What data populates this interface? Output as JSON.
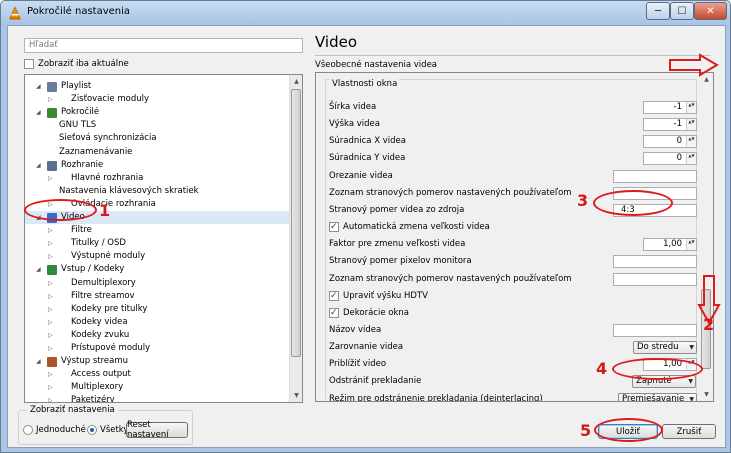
{
  "window": {
    "title": "Pokročilé nastavenia",
    "controls": {
      "minimize": "─",
      "maximize": "☐",
      "close": "✕"
    }
  },
  "search": {
    "placeholder": "Hľadať"
  },
  "only_current": {
    "label": "Zobraziť iba aktuálne",
    "checked": false
  },
  "tree": [
    {
      "label": "Playlist",
      "level": 0,
      "expanded": true,
      "icon": "playlist-icon",
      "color": "#6a7da0"
    },
    {
      "label": "Zisťovacie moduly",
      "level": 1,
      "expanded": false
    },
    {
      "label": "Pokročilé",
      "level": 0,
      "expanded": true,
      "icon": "advanced-icon",
      "color": "#3a8a30"
    },
    {
      "label": "GNU TLS",
      "level": 1,
      "leaf": true
    },
    {
      "label": "Sieťová synchronizácia",
      "level": 1,
      "leaf": true
    },
    {
      "label": "Zaznamenávanie",
      "level": 1,
      "leaf": true
    },
    {
      "label": "Rozhranie",
      "level": 0,
      "expanded": true,
      "icon": "interface-icon",
      "color": "#5b6f92"
    },
    {
      "label": "Hlavné rozhrania",
      "level": 1,
      "expanded": false
    },
    {
      "label": "Nastavenia klávesových skratiek",
      "level": 1,
      "leaf": true
    },
    {
      "label": "Ovládacie rozhrania",
      "level": 1,
      "expanded": false
    },
    {
      "label": "Video",
      "level": 0,
      "expanded": true,
      "icon": "video-icon",
      "color": "#2f6fd0",
      "selected": true
    },
    {
      "label": "Filtre",
      "level": 1,
      "expanded": false
    },
    {
      "label": "Titulky / OSD",
      "level": 1,
      "expanded": false
    },
    {
      "label": "Výstupné moduly",
      "level": 1,
      "expanded": false
    },
    {
      "label": "Vstup / Kodeky",
      "level": 0,
      "expanded": true,
      "icon": "input-codecs-icon",
      "color": "#2c8a3c"
    },
    {
      "label": "Demultiplexory",
      "level": 1,
      "expanded": false
    },
    {
      "label": "Filtre streamov",
      "level": 1,
      "expanded": false
    },
    {
      "label": "Kodeky pre titulky",
      "level": 1,
      "expanded": false
    },
    {
      "label": "Kodeky videa",
      "level": 1,
      "expanded": false
    },
    {
      "label": "Kodeky zvuku",
      "level": 1,
      "expanded": false
    },
    {
      "label": "Prístupové moduly",
      "level": 1,
      "expanded": false
    },
    {
      "label": "Výstup streamu",
      "level": 0,
      "expanded": true,
      "icon": "stream-output-icon",
      "color": "#b0522a"
    },
    {
      "label": "Access output",
      "level": 1,
      "expanded": false
    },
    {
      "label": "Multiplexory",
      "level": 1,
      "expanded": false
    },
    {
      "label": "Paketizéry",
      "level": 1,
      "expanded": false
    }
  ],
  "show_settings": {
    "caption": "Zobraziť nastavenia",
    "simple": "Jednoduché",
    "all": "Všetky",
    "selected": "all"
  },
  "reset_button": "Reset nastavení",
  "page": {
    "title": "Video",
    "section": "Všeobecné nastavenia videa",
    "group": "Vlastnosti okna"
  },
  "fields": [
    {
      "label": "Šírka videa",
      "type": "spin",
      "value": "-1"
    },
    {
      "label": "Výška videa",
      "type": "spin",
      "value": "-1"
    },
    {
      "label": "Súradnica X videa",
      "type": "spin",
      "value": "0"
    },
    {
      "label": "Súradnica Y videa",
      "type": "spin",
      "value": "0"
    },
    {
      "label": "Orezanie videa",
      "type": "text",
      "value": ""
    },
    {
      "label": "Zoznam stranových pomerov nastavených používateľom",
      "type": "text",
      "value": ""
    },
    {
      "label": "Stranový pomer videa zo zdroja",
      "type": "text",
      "value": "4:3"
    },
    {
      "label": "Automatická zmena veľkosti videa",
      "type": "checkbox",
      "checked": true
    },
    {
      "label": "Faktor pre zmenu veľkosti videa",
      "type": "spin",
      "value": "1,00"
    },
    {
      "label": "Stranový pomer pixelov monitora",
      "type": "text",
      "value": ""
    },
    {
      "label": "Zoznam stranových pomerov nastavených používateľom",
      "type": "text",
      "value": ""
    },
    {
      "label": "Upraviť výšku HDTV",
      "type": "checkbox",
      "checked": true
    },
    {
      "label": "Dekorácie okna",
      "type": "checkbox",
      "checked": true
    },
    {
      "label": "Názov videa",
      "type": "text",
      "value": ""
    },
    {
      "label": "Zarovnanie videa",
      "type": "combo",
      "value": "Do stredu"
    },
    {
      "label": "Priblížiť video",
      "type": "spin",
      "value": "1,00"
    },
    {
      "label": "Odstrániť prekladanie",
      "type": "combo",
      "value": "Zapnuté"
    },
    {
      "label": "Režim pre odstránenie prekladania (deinterlacing)",
      "type": "combo",
      "value": "Premiešavanie"
    }
  ],
  "buttons": {
    "save": "Uložiť",
    "close": "Zrušiť"
  },
  "annotations": {
    "n1": "1",
    "n2": "2",
    "n3": "3",
    "n4": "4",
    "n5": "5",
    "color": "#e01a1a"
  }
}
